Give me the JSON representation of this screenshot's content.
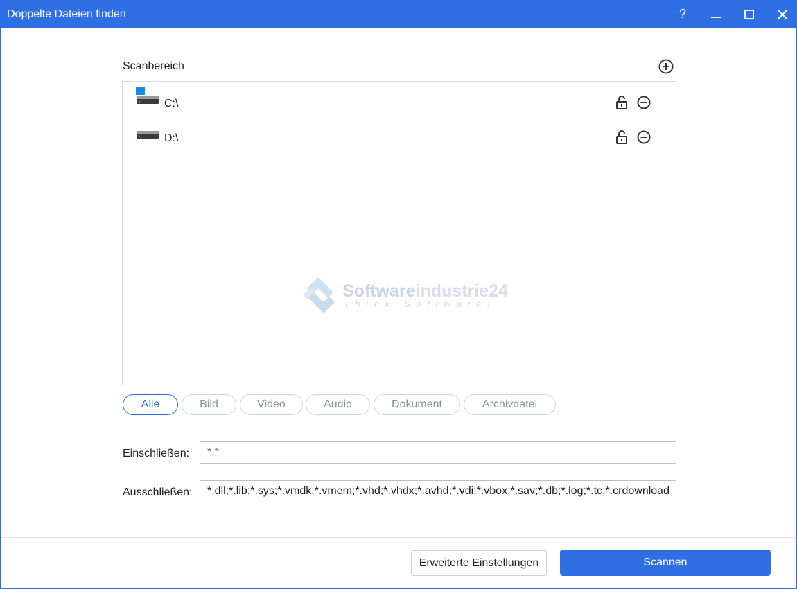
{
  "window": {
    "title": "Doppelte Dateien finden",
    "help_label": "?",
    "accent_color": "#2f6fe6"
  },
  "scan": {
    "label": "Scanbereich",
    "add_icon": "plus-circle-icon",
    "drives": [
      {
        "label": "C:\\",
        "icon": "system-drive-icon",
        "lock_icon": "unlocked-icon",
        "remove_icon": "minus-circle-icon"
      },
      {
        "label": "D:\\",
        "icon": "drive-icon",
        "lock_icon": "unlocked-icon",
        "remove_icon": "minus-circle-icon"
      }
    ]
  },
  "watermark": {
    "name_part1": "Software",
    "name_part2": "industrie24",
    "tagline": "Think Software!"
  },
  "filters": {
    "tabs": [
      "Alle",
      "Bild",
      "Video",
      "Audio",
      "Dokument",
      "Archivdatei"
    ],
    "active": "Alle"
  },
  "include": {
    "label": "Einschließen:",
    "value": "*.*"
  },
  "exclude": {
    "label": "Ausschließen:",
    "value": "*.dll;*.lib;*.sys;*.vmdk;*.vmem;*.vhd;*.vhdx;*.avhd;*.vdi;*.vbox;*.sav;*.db;*.log;*.tc;*.crdownload"
  },
  "footer": {
    "advanced_label": "Erweiterte Einstellungen",
    "scan_label": "Scannen"
  }
}
